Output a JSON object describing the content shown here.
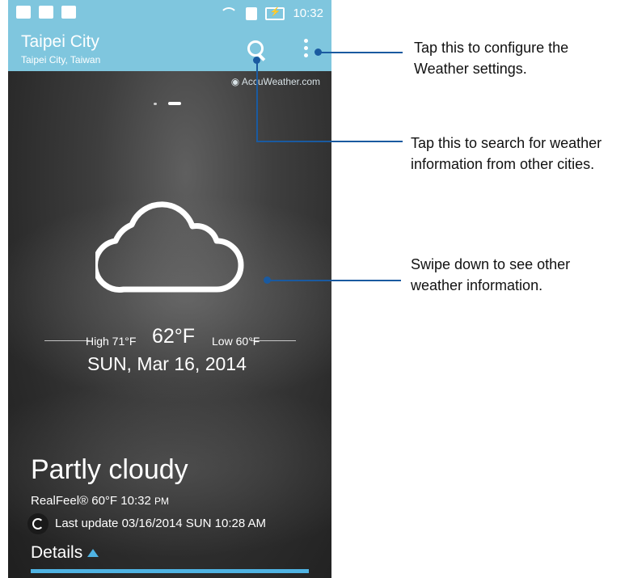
{
  "status_bar": {
    "time": "10:32"
  },
  "app_bar": {
    "city": "Taipei City",
    "subcity": "Taipei City, Taiwan"
  },
  "provider": "AccuWeather.com",
  "weather": {
    "high": "High 71°F",
    "current_temp": "62°F",
    "low": "Low 60°F",
    "date": "SUN, Mar 16, 2014",
    "condition": "Partly cloudy",
    "realfeel": "RealFeel® 60°F  10:32",
    "realfeel_suffix": "PM",
    "last_update": "Last update 03/16/2014 SUN 10:28 AM",
    "details_label": "Details"
  },
  "annotations": {
    "settings": [
      "Tap this to configure the",
      "Weather settings."
    ],
    "search": [
      "Tap this to search for weather",
      "information from other cities."
    ],
    "swipe": [
      "Swipe down to see other",
      "weather information."
    ]
  },
  "colors": {
    "app_bar": "#7fc6de",
    "accent": "#4fb3e3",
    "callout": "#1a5aa0"
  }
}
